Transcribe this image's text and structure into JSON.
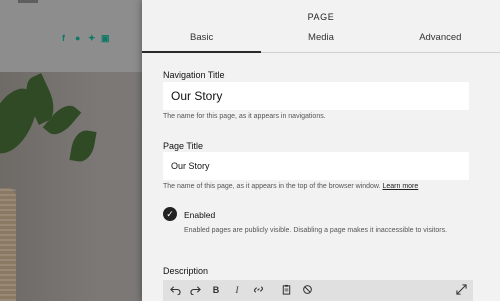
{
  "background": {
    "social_icons": [
      "facebook-icon",
      "snapchat-icon",
      "twitter-icon",
      "instagram-icon"
    ],
    "accent_color": "#0c7a64"
  },
  "panel": {
    "title": "PAGE",
    "tabs": [
      {
        "label": "Basic",
        "active": true
      },
      {
        "label": "Media",
        "active": false
      },
      {
        "label": "Advanced",
        "active": false
      }
    ],
    "navigation_title": {
      "label": "Navigation Title",
      "value": "Our Story",
      "hint": "The name for this page, as it appears in navigations."
    },
    "page_title": {
      "label": "Page Title",
      "value": "Our Story",
      "hint": "The name of this page, as it appears in the top of the browser window.",
      "hint_link": "Learn more"
    },
    "enabled": {
      "checked": true,
      "label": "Enabled",
      "description": "Enabled pages are publicly visible. Disabling a page makes it inaccessible to visitors."
    },
    "description": {
      "label": "Description",
      "toolbar": [
        "undo-icon",
        "redo-icon",
        "bold-icon",
        "italic-icon",
        "link-icon",
        "paste-icon",
        "clear-format-icon",
        "expand-icon"
      ],
      "toolbar_glyphs": {
        "bold": "B",
        "italic": "I"
      }
    }
  }
}
